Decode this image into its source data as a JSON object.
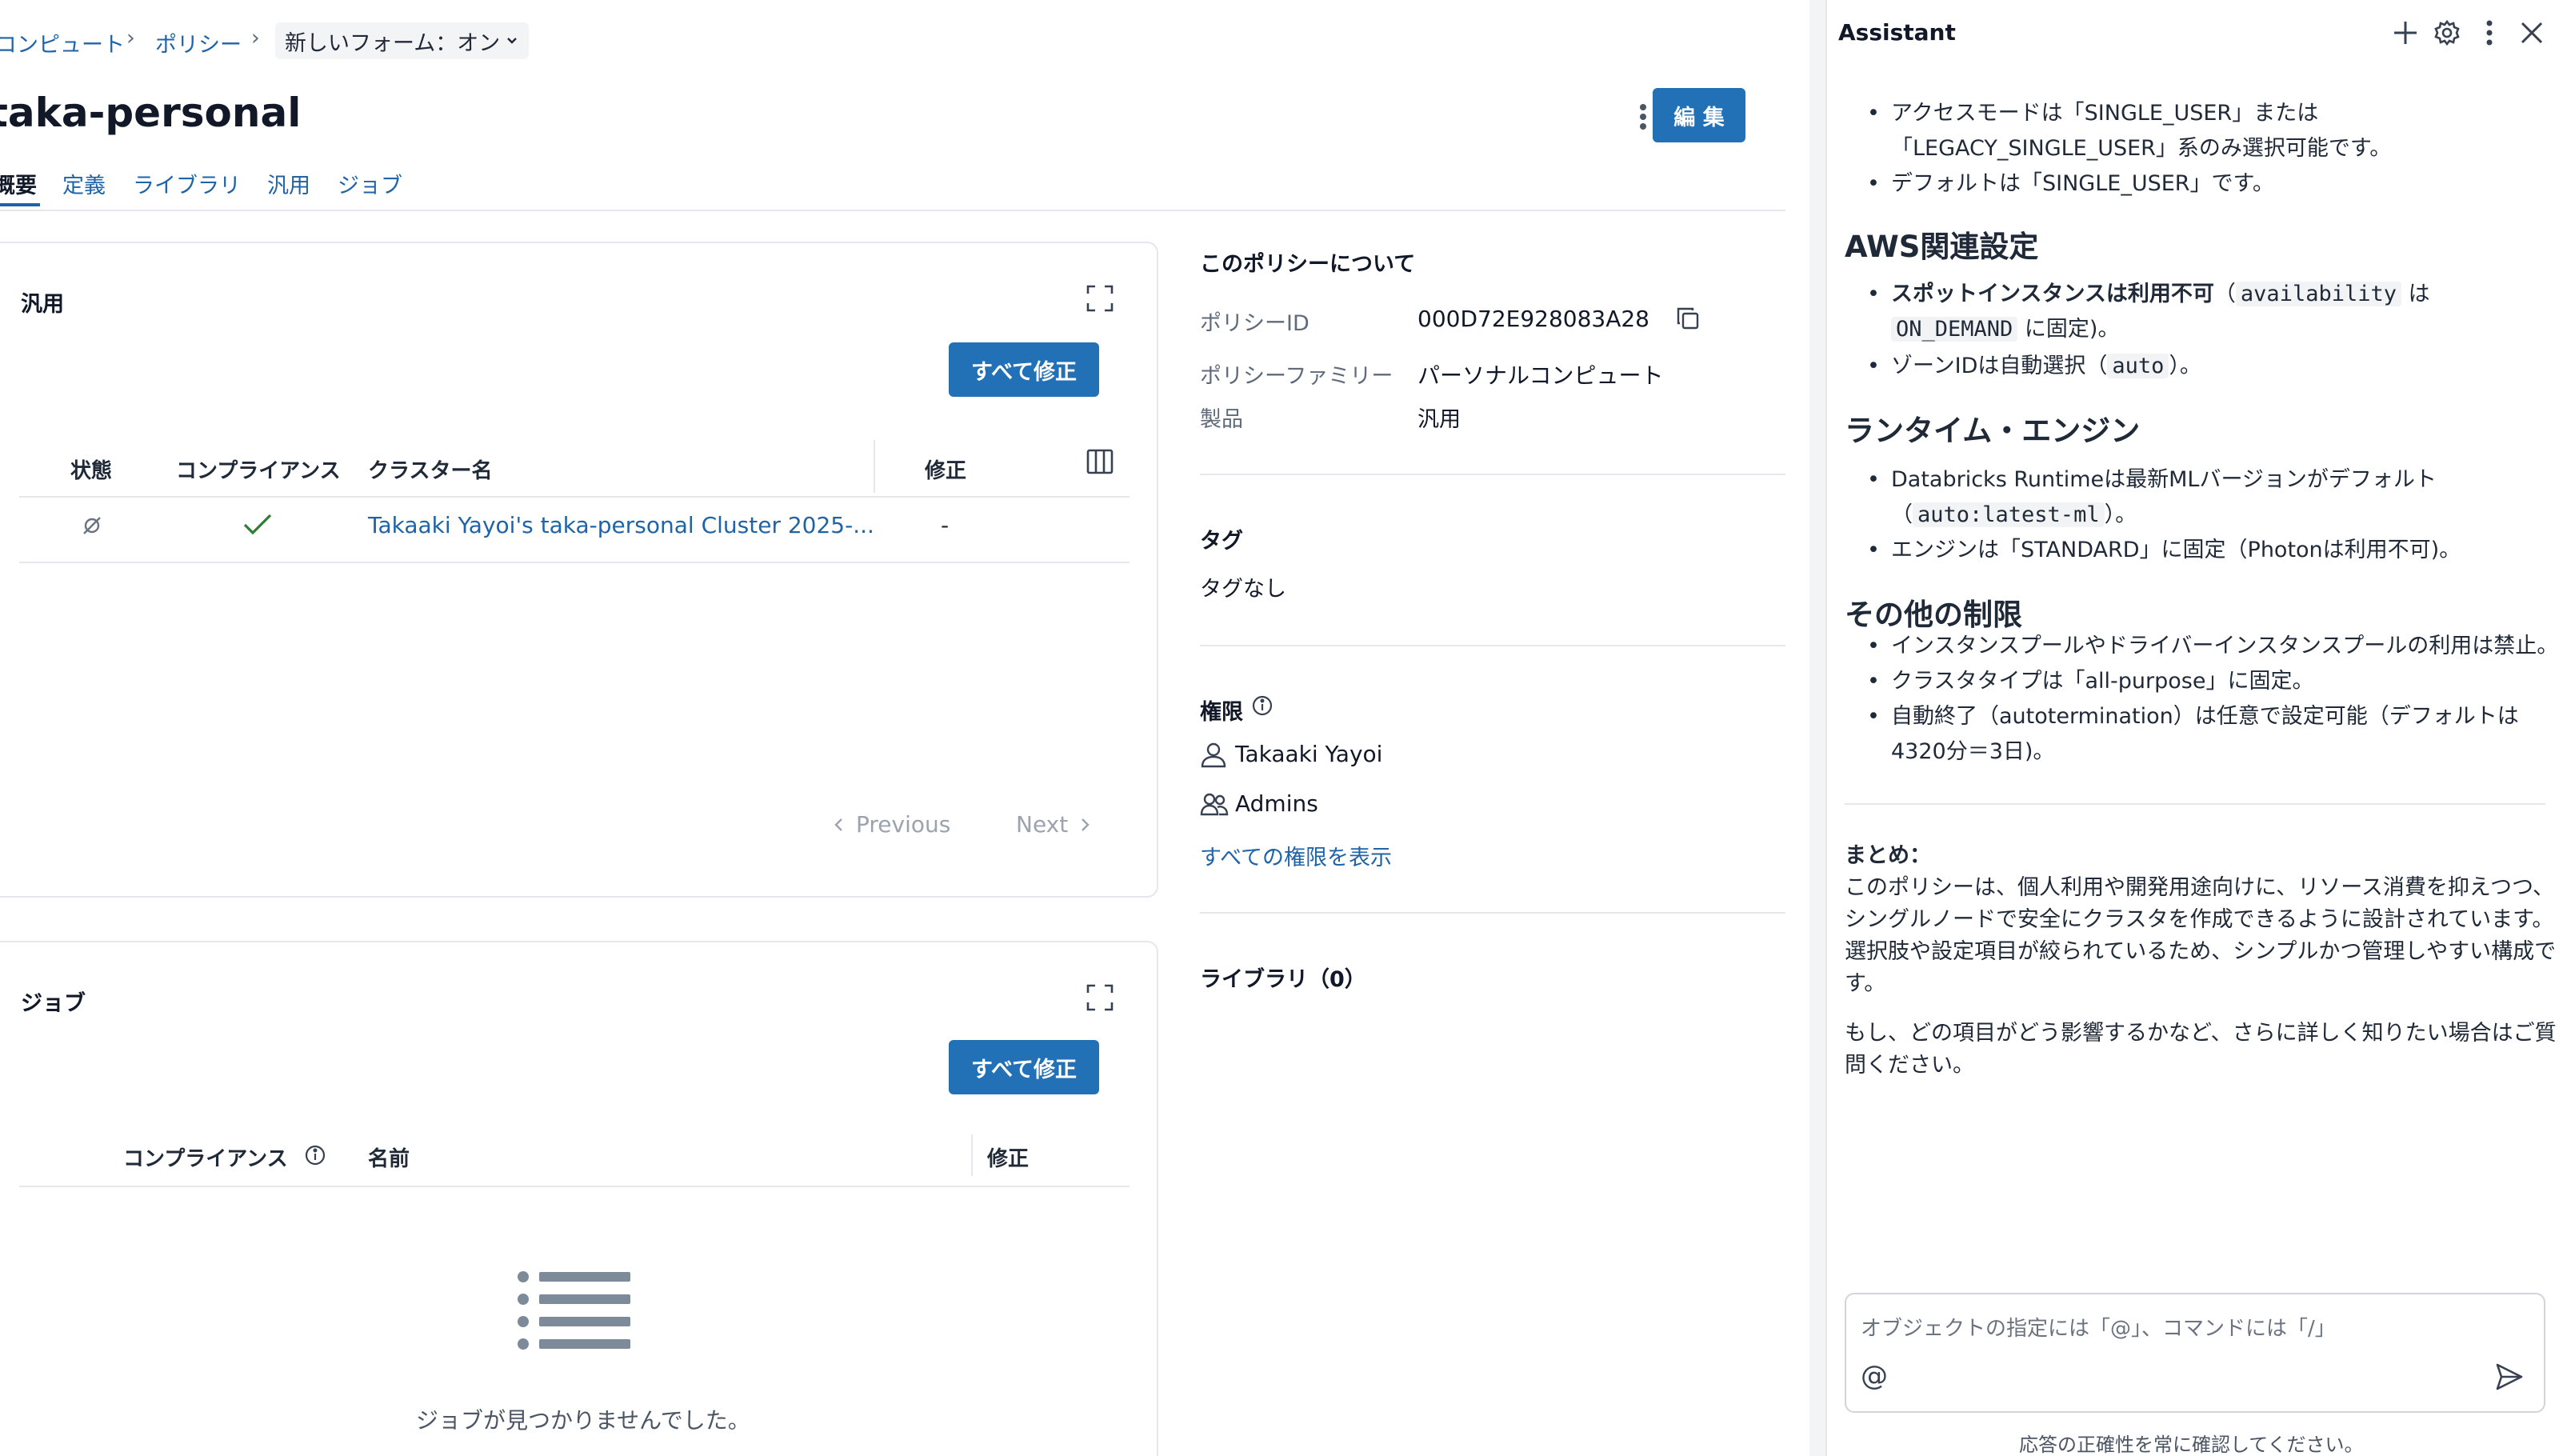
{
  "breadcrumb": {
    "item1": "コンピュート",
    "item2": "ポリシー",
    "sep": "›",
    "dropdown": "新しいフォーム：オン"
  },
  "page": {
    "title": "taka-personal",
    "edit_label": "編 集",
    "tabs": [
      "概要",
      "定義",
      "ライブラリ",
      "汎用",
      "ジョブ"
    ]
  },
  "general_card": {
    "title": "汎用",
    "fix_all_label": "すべて修正",
    "columns": [
      "状態",
      "コンプライアンス",
      "クラスター名",
      "修正"
    ],
    "rows": [
      {
        "cluster_name": "Takaaki Yayoi's taka-personal Cluster 2025-...",
        "fix": "-"
      }
    ],
    "pagination": {
      "previous": "Previous",
      "next": "Next"
    }
  },
  "jobs_card": {
    "title": "ジョブ",
    "fix_all_label": "すべて修正",
    "columns": [
      "コンプライアンス",
      "名前",
      "修正"
    ],
    "empty_text": "ジョブが見つかりませんでした。"
  },
  "about": {
    "heading": "このポリシーについて",
    "policy_id_label": "ポリシーID",
    "policy_id_value": "000D72E928083A28",
    "family_label": "ポリシーファミリー",
    "family_value": "パーソナルコンピュート",
    "product_label": "製品",
    "product_value": "汎用",
    "tags_heading": "タグ",
    "tags_value": "タグなし",
    "permissions_heading": "権限",
    "permission_user": "Takaaki Yayoi",
    "permission_group": "Admins",
    "show_all_permissions": "すべての権限を表示",
    "libraries_heading": "ライブラリ（0）"
  },
  "assistant": {
    "title": "Assistant",
    "access_mode": {
      "b1_pre": "アクセスモードは「SINGLE_USER」または",
      "b1_post": "「LEGACY_SINGLE_USER」系のみ選択可能です。",
      "b2": "デフォルトは「SINGLE_USER」です。"
    },
    "aws_heading": "AWS関連設定",
    "aws": {
      "b1_bold": "スポットインスタンスは利用不可",
      "b1_paren_open": "（",
      "b1_code": "availability",
      "b1_mid": "は",
      "b1_code2": "ON_DEMAND",
      "b1_tail": "に固定)。",
      "b2_pre": "ゾーンIDは自動選択（",
      "b2_code": "auto",
      "b2_post": "）。"
    },
    "runtime_heading": "ランタイム・エンジン",
    "runtime": {
      "b1_pre": "Databricks Runtimeは最新MLバージョンがデフォルト",
      "b1_open": "（",
      "b1_code": "auto:latest-ml",
      "b1_close": "）。",
      "b2": "エンジンは「STANDARD」に固定（Photonは利用不可)。"
    },
    "other_heading": "その他の制限",
    "other": {
      "b1": "インスタンスプールやドライバーインスタンスプールの利用は禁止。",
      "b2": "クラスタタイプは「all-purpose」に固定。",
      "b3_l1": "自動終了（autotermination）は任意で設定可能（デフォルトは",
      "b3_l2": "4320分＝3日)。"
    },
    "summary_heading": "まとめ：",
    "summary_l1": "このポリシーは、個人利用や開発用途向けに、リソース消費を抑えつつ、",
    "summary_l2": "シングルノードで安全にクラスタを作成できるように設計されています。",
    "summary_l3": "選択肢や設定項目が絞られているため、シンプルかつ管理しやすい構成で",
    "summary_l4": "す。",
    "followup_l1": "もし、どの項目がどう影響するかなど、さらに詳しく知りたい場合はご質",
    "followup_l2": "問ください。",
    "input_placeholder": "オブジェクトの指定には「@」、コマンドには「/」",
    "at_symbol": "@",
    "disclaimer": "応答の正確性を常に確認してください。"
  },
  "colors": {
    "primary": "#2270b6",
    "link": "#1f63a8",
    "success": "#2e7d32",
    "border": "#e5e7eb"
  }
}
